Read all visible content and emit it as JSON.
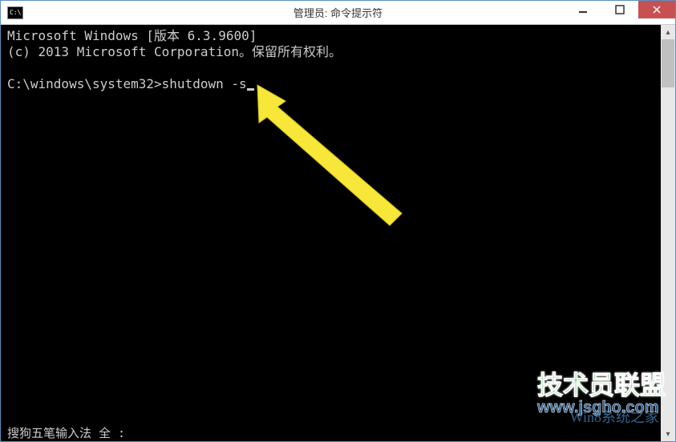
{
  "window": {
    "title": "管理员: 命令提示符",
    "icon_label": "C:\\"
  },
  "terminal": {
    "line1": "Microsoft Windows [版本 6.3.9600]",
    "line2": "(c) 2013 Microsoft Corporation。保留所有权利。",
    "prompt": "C:\\windows\\system32>",
    "command": "shutdown -s"
  },
  "ime": {
    "status": "搜狗五笔输入法 全 :"
  },
  "watermark": {
    "main_cn": "技术员联盟",
    "main_en": "www.jsgho.com",
    "sub": "Win8系统之家"
  }
}
